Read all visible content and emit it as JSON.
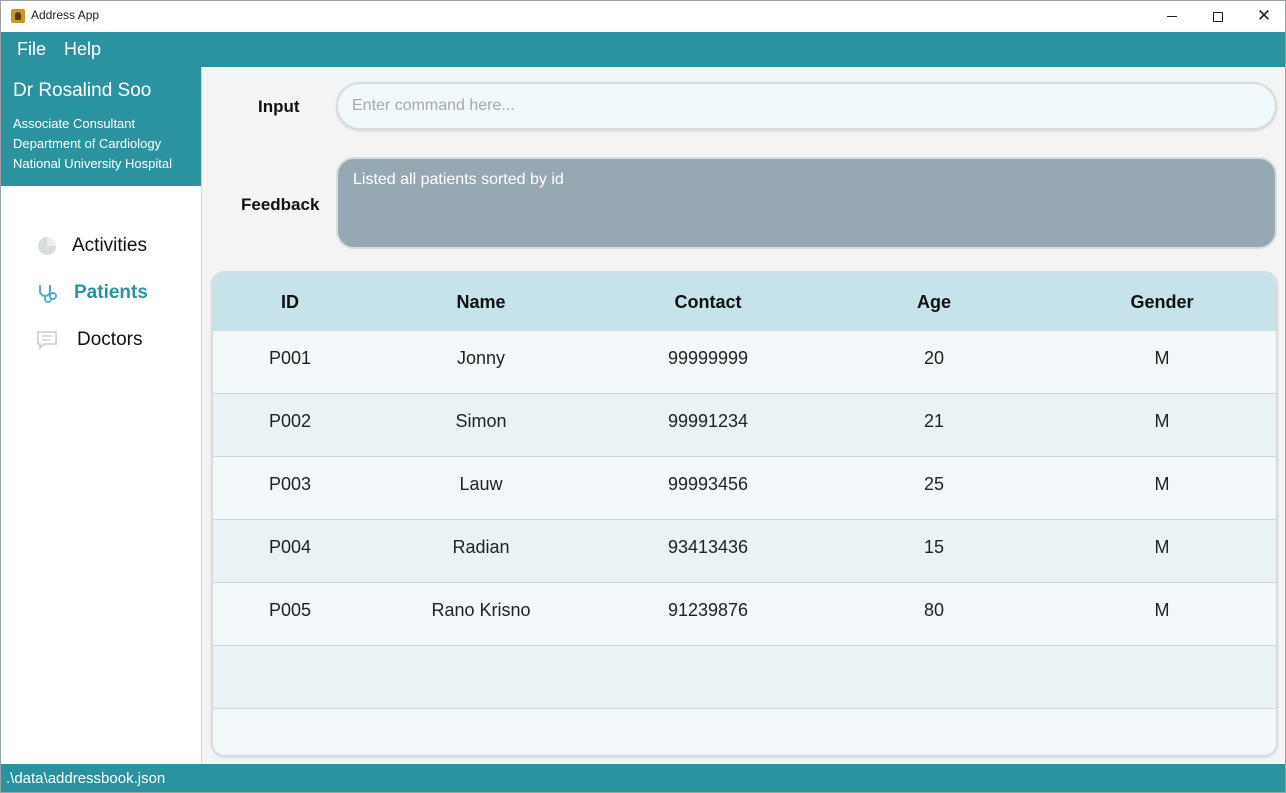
{
  "window": {
    "title": "Address App",
    "minimize_icon": "minimize-icon",
    "maximize_icon": "maximize-icon",
    "close_glyph": "✕"
  },
  "menu": {
    "file": "File",
    "help": "Help"
  },
  "profile": {
    "name": "Dr Rosalind Soo",
    "role": "Associate Consultant",
    "department": "Department of Cardiology",
    "hospital": "National University Hospital"
  },
  "nav": {
    "activities": "Activities",
    "patients": "Patients",
    "doctors": "Doctors",
    "active": "patients"
  },
  "command": {
    "label": "Input",
    "placeholder": "Enter command here...",
    "value": ""
  },
  "feedback": {
    "label": "Feedback",
    "text": "Listed all patients sorted by id"
  },
  "table": {
    "headers": [
      "ID",
      "Name",
      "Contact",
      "Age",
      "Gender"
    ],
    "rows": [
      [
        "P001",
        "Jonny",
        "99999999",
        "20",
        "M"
      ],
      [
        "P002",
        "Simon",
        "99991234",
        "21",
        "M"
      ],
      [
        "P003",
        "Lauw",
        "99993456",
        "25",
        "M"
      ],
      [
        "P004",
        "Radian",
        "93413436",
        "15",
        "M"
      ],
      [
        "P005",
        "Rano Krisno",
        "91239876",
        "80",
        "M"
      ]
    ]
  },
  "status": {
    "path": ".\\data\\addressbook.json"
  },
  "colors": {
    "accent": "#2a939f",
    "feedback_bg": "#96a9b3",
    "table_header_bg": "#c6e3ec"
  }
}
